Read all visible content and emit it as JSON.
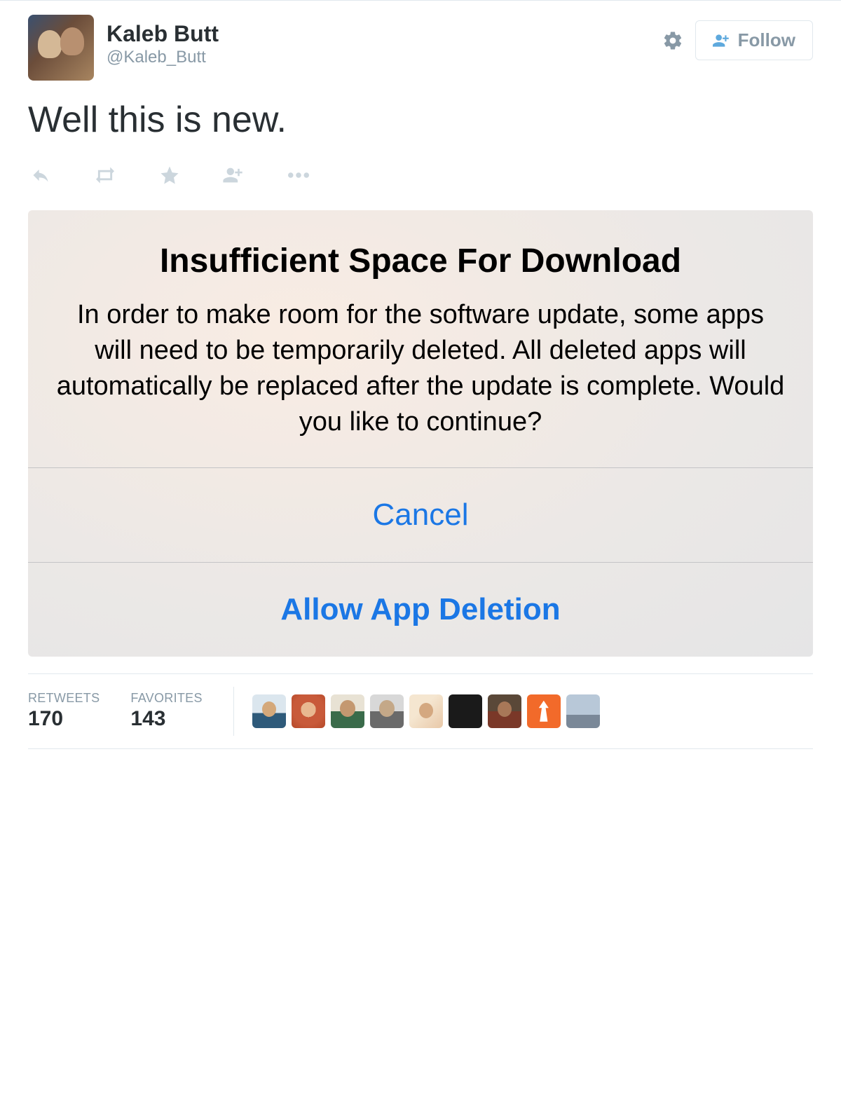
{
  "user": {
    "display_name": "Kaleb Butt",
    "username": "@Kaleb_Butt"
  },
  "header": {
    "follow_label": "Follow"
  },
  "tweet": {
    "text": "Well this is new."
  },
  "dialog": {
    "title": "Insufficient Space For Download",
    "message": "In order to make room for the software update, some apps will need to be temporarily deleted. All deleted apps will automatically be replaced after the update is complete. Would you like to continue?",
    "cancel_label": "Cancel",
    "allow_label": "Allow App Deletion"
  },
  "stats": {
    "retweets_label": "RETWEETS",
    "retweets_value": "170",
    "favorites_label": "FAVORITES",
    "favorites_value": "143"
  }
}
